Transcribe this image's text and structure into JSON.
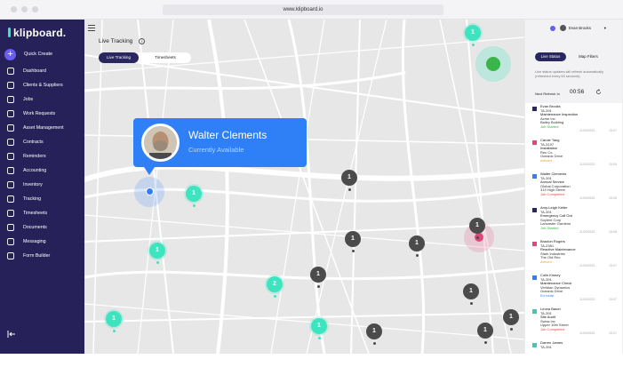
{
  "browser": {
    "url": "www.klipboard.io"
  },
  "app": {
    "logo_text": "klipboard."
  },
  "sidebar": {
    "quick_create": "Quick Create",
    "items": [
      {
        "label": "Dashboard",
        "icon": "dashboard-icon"
      },
      {
        "label": "Clients & Suppliers",
        "icon": "clients-icon"
      },
      {
        "label": "Jobs",
        "icon": "jobs-icon"
      },
      {
        "label": "Work Requests",
        "icon": "work-requests-icon"
      },
      {
        "label": "Asset Management",
        "icon": "asset-icon"
      },
      {
        "label": "Contracts",
        "icon": "contracts-icon"
      },
      {
        "label": "Reminders",
        "icon": "reminders-icon"
      },
      {
        "label": "Accounting",
        "icon": "accounting-icon"
      },
      {
        "label": "Inventory",
        "icon": "inventory-icon"
      },
      {
        "label": "Tracking",
        "icon": "tracking-icon"
      },
      {
        "label": "Timesheets",
        "icon": "timesheets-icon"
      },
      {
        "label": "Documents",
        "icon": "documents-icon"
      },
      {
        "label": "Messaging",
        "icon": "messaging-icon"
      },
      {
        "label": "Form Builder",
        "icon": "form-builder-icon"
      }
    ]
  },
  "map": {
    "title": "Live Tracking",
    "tabs": [
      "Live Tracking",
      "Timesheets"
    ],
    "popup": {
      "name": "Walter Clements",
      "status": "Currently Available"
    },
    "clusters": [
      "1",
      "1",
      "1",
      "1",
      "1",
      "2",
      "1",
      "1",
      "1",
      "1",
      "1",
      "1",
      "1",
      "1",
      "1",
      "1"
    ]
  },
  "right_panel": {
    "user_name": "Evan Brooks",
    "tabs": [
      "Live Status",
      "Map Filters"
    ],
    "description": "Live status updates will refresh automatically (refreshed every 60 seconds)",
    "next_refresh_label": "Next Refresh In",
    "timer": "00:56",
    "jobs": [
      {
        "name": "Evan Brooks",
        "ref": "TA-391",
        "title": "Maintenance Inspection",
        "company": "Acme Inc",
        "location": "Bailey Building",
        "status": "Job Started",
        "status_color": "#3ab54a",
        "date": "11/03/2021",
        "time": "15:07",
        "color": "#2a2660"
      },
      {
        "name": "Carole Tang",
        "ref": "TA-3197",
        "title": "Installation",
        "company": "Rex Co.",
        "location": "Oceanic Drive",
        "status": "Arrived",
        "status_color": "#f0a020",
        "date": "11/03/2021",
        "time": "15:05",
        "color": "#e0487a"
      },
      {
        "name": "Walter Clements",
        "ref": "TA-391",
        "title": "Annual Service",
        "company": "Global Corporation",
        "location": "319 High Street",
        "status": "Job Completed",
        "status_color": "#e8453c",
        "date": "11/03/2021",
        "time": "15:05",
        "color": "#2f80f7"
      },
      {
        "name": "Amy-Leigh Keller",
        "ref": "TA-391",
        "title": "Emergency Call Out",
        "company": "Soylent Corp",
        "location": "Lancaster Gardens",
        "status": "Job Started",
        "status_color": "#3ab54a",
        "date": "11/03/2021",
        "time": "15:08",
        "color": "#2a2660"
      },
      {
        "name": "Braxton Rogers",
        "ref": "TA-2381",
        "title": "Reactive Maintenance",
        "company": "Stark Industries",
        "location": "The Old Rec",
        "status": "Arrived",
        "status_color": "#f0a020",
        "date": "11/03/2021",
        "time": "15:07",
        "color": "#e0487a"
      },
      {
        "name": "Colin Kinney",
        "ref": "TA-391",
        "title": "Maintenance Check",
        "company": "Veridian Dynamics",
        "location": "Oceanic Drive",
        "status": "En route",
        "status_color": "#2f80f7",
        "date": "11/03/2021",
        "time": "15:07",
        "color": "#2f80f7"
      },
      {
        "name": "Leona Bauer",
        "ref": "TA-391",
        "title": "Site Audit",
        "company": "Swiss Inc",
        "location": "Upper 10th Street",
        "status": "Job Completed",
        "status_color": "#e8453c",
        "date": "11/03/2021",
        "time": "15:07",
        "color": "#3ec9b0"
      },
      {
        "name": "Darren James",
        "ref": "TA-391",
        "title": "",
        "company": "",
        "location": "",
        "status": "",
        "status_color": "#aaa",
        "date": "",
        "time": "",
        "color": "#3ec9b0"
      }
    ]
  }
}
